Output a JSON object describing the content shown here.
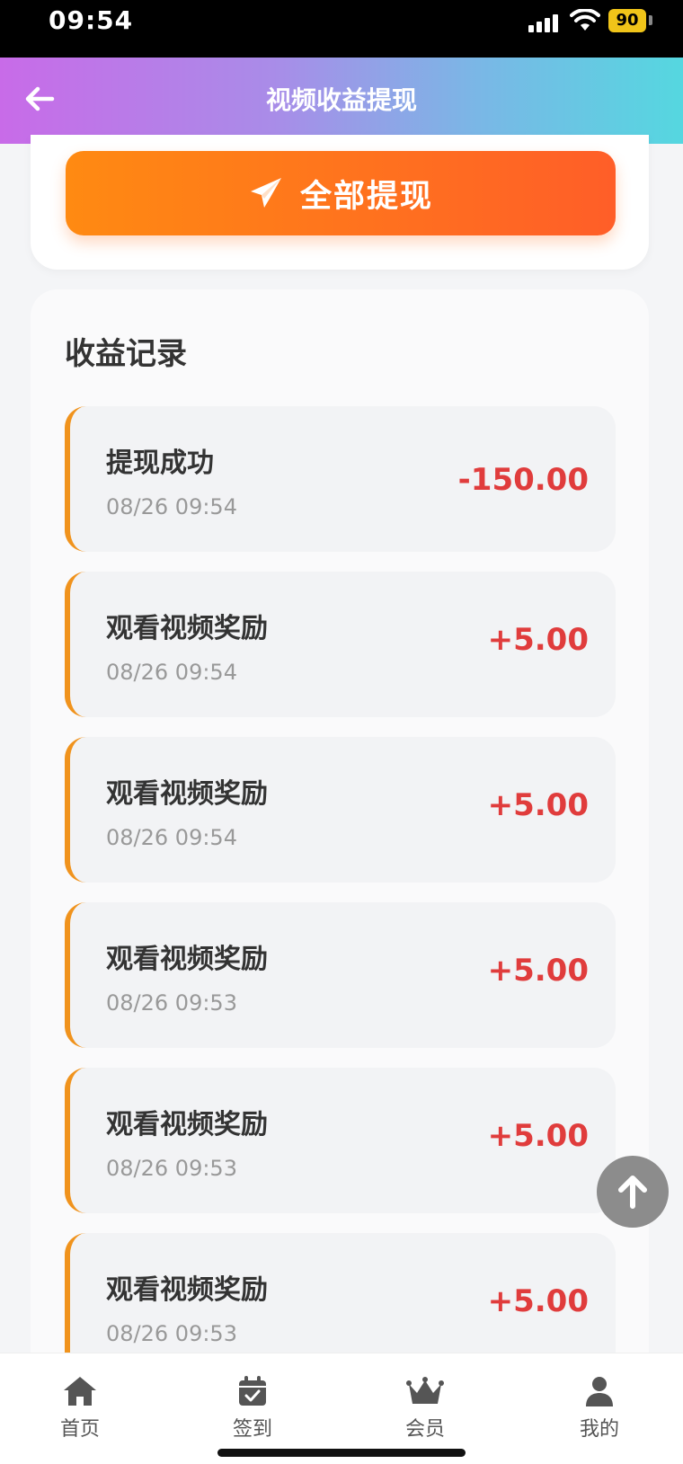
{
  "status_bar": {
    "time": "09:54",
    "battery": "90"
  },
  "nav": {
    "title": "视频收益提现"
  },
  "withdraw": {
    "label": "全部提现"
  },
  "records": {
    "title": "收益记录",
    "items": [
      {
        "title": "提现成功",
        "time": "08/26 09:54",
        "amount": "-150.00"
      },
      {
        "title": "观看视频奖励",
        "time": "08/26 09:54",
        "amount": "+5.00"
      },
      {
        "title": "观看视频奖励",
        "time": "08/26 09:54",
        "amount": "+5.00"
      },
      {
        "title": "观看视频奖励",
        "time": "08/26 09:53",
        "amount": "+5.00"
      },
      {
        "title": "观看视频奖励",
        "time": "08/26 09:53",
        "amount": "+5.00"
      },
      {
        "title": "观看视频奖励",
        "time": "08/26 09:53",
        "amount": "+5.00"
      }
    ]
  },
  "tabs": [
    {
      "label": "首页",
      "icon": "home-icon"
    },
    {
      "label": "签到",
      "icon": "calendar-check-icon"
    },
    {
      "label": "会员",
      "icon": "crown-icon"
    },
    {
      "label": "我的",
      "icon": "user-icon"
    }
  ],
  "colors": {
    "accent_orange": "#ff7a1a",
    "amount_red": "#e03c3c",
    "record_border": "#f0931d"
  }
}
